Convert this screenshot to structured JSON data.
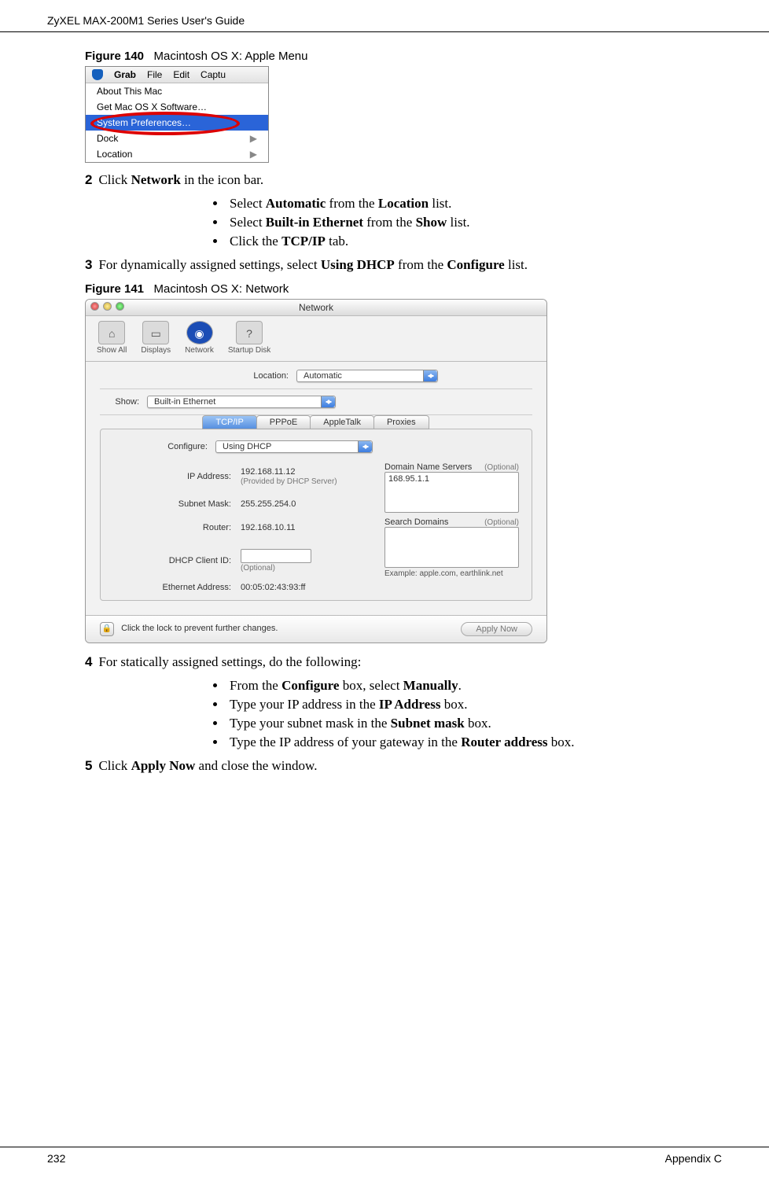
{
  "header": {
    "title": "ZyXEL MAX-200M1 Series User's Guide"
  },
  "fig140": {
    "label": "Figure 140",
    "caption": "Macintosh OS X: Apple Menu",
    "menubar": {
      "grab": "Grab",
      "file": "File",
      "edit": "Edit",
      "captu": "Captu"
    },
    "items": {
      "about": "About This Mac",
      "getsw": "Get Mac OS X Software…",
      "sysprefs": "System Preferences…",
      "dock": "Dock",
      "location": "Location"
    }
  },
  "steps": {
    "s2": {
      "num": "2",
      "text_a": "Click ",
      "text_b": "Network",
      "text_c": " in the icon bar."
    },
    "b1_a": "Select ",
    "b1_b": "Automatic",
    "b1_c": " from the ",
    "b1_d": "Location",
    "b1_e": " list.",
    "b2_a": "Select ",
    "b2_b": "Built-in Ethernet",
    "b2_c": " from the ",
    "b2_d": "Show",
    "b2_e": " list.",
    "b3_a": "Click the ",
    "b3_b": "TCP/IP",
    "b3_c": " tab.",
    "s3": {
      "num": "3",
      "a": "For dynamically assigned settings, select ",
      "b": "Using DHCP",
      "c": " from the ",
      "d": "Configure",
      "e": " list."
    }
  },
  "fig141": {
    "label": "Figure 141",
    "caption": "Macintosh OS X: Network",
    "window_title": "Network",
    "toolbar": {
      "showall": "Show All",
      "displays": "Displays",
      "network": "Network",
      "startup": "Startup Disk"
    },
    "location_label": "Location:",
    "location_value": "Automatic",
    "show_label": "Show:",
    "show_value": "Built-in Ethernet",
    "tabs": {
      "tcpip": "TCP/IP",
      "pppoe": "PPPoE",
      "appletalk": "AppleTalk",
      "proxies": "Proxies"
    },
    "configure_label": "Configure:",
    "configure_value": "Using DHCP",
    "ipaddr_label": "IP Address:",
    "ipaddr_value": "192.168.11.12",
    "ipaddr_note": "(Provided by DHCP Server)",
    "subnet_label": "Subnet Mask:",
    "subnet_value": "255.255.254.0",
    "router_label": "Router:",
    "router_value": "192.168.10.11",
    "dhcpid_label": "DHCP Client ID:",
    "dhcpid_note": "(Optional)",
    "ethaddr_label": "Ethernet Address:",
    "ethaddr_value": "00:05:02:43:93:ff",
    "dns_label": "Domain Name Servers",
    "dns_opt": "(Optional)",
    "dns_value": "168.95.1.1",
    "search_label": "Search Domains",
    "search_opt": "(Optional)",
    "example_note": "Example: apple.com, earthlink.net",
    "lock_text": "Click the lock to prevent further changes.",
    "apply_btn": "Apply Now"
  },
  "steps2": {
    "s4": {
      "num": "4",
      "text": "For statically assigned settings, do the following:"
    },
    "b1_a": "From the ",
    "b1_b": "Configure",
    "b1_c": " box, select ",
    "b1_d": "Manually",
    "b1_e": ".",
    "b2_a": "Type your IP address in the ",
    "b2_b": "IP Address",
    "b2_c": " box.",
    "b3_a": "Type your subnet mask in the ",
    "b3_b": "Subnet mask",
    "b3_c": " box.",
    "b4_a": "Type the IP address of your gateway in the ",
    "b4_b": "Router address",
    "b4_c": " box.",
    "s5": {
      "num": "5",
      "a": "Click ",
      "b": "Apply Now",
      "c": " and close the window."
    }
  },
  "footer": {
    "page": "232",
    "appendix": "Appendix C"
  }
}
